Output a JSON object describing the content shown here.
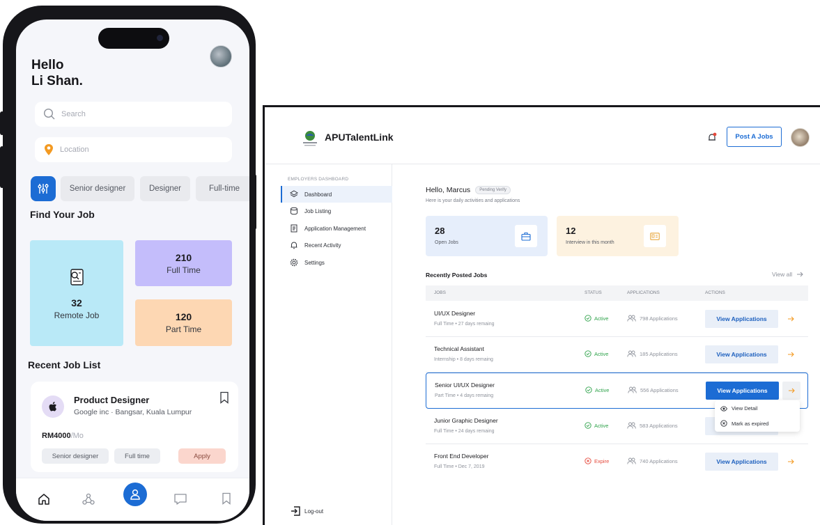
{
  "mobile": {
    "greeting_line1": "Hello",
    "greeting_line2": "Li Shan.",
    "search_placeholder": "Search",
    "location_placeholder": "Location",
    "filter_chips": [
      "Senior designer",
      "Designer",
      "Full-time"
    ],
    "find_job_title": "Find Your Job",
    "stats": {
      "remote": {
        "value": "32",
        "label": "Remote Job"
      },
      "full_time": {
        "value": "210",
        "label": "Full Time"
      },
      "part_time": {
        "value": "120",
        "label": "Part Time"
      }
    },
    "recent_title": "Recent Job List",
    "recent_job": {
      "title": "Product Designer",
      "company": "Google inc · Bangsar, Kuala Lumpur",
      "salary": "RM4000",
      "salary_period": "/Mo",
      "tags": [
        "Senior designer",
        "Full time"
      ],
      "apply_label": "Apply"
    },
    "colors": {
      "accent": "#1c6cd4",
      "remote_card": "#b9e9f7",
      "full_time_card": "#c4bdfb",
      "part_time_card": "#fdd7b3",
      "apply": "#fbd6cd"
    }
  },
  "desktop": {
    "brand": "APUTalentLink",
    "post_button": "Post A Jobs",
    "sidebar": {
      "section_title": "EMPLOYERS DASHBOARD",
      "items": [
        {
          "label": "Dashboard",
          "icon": "layers-icon"
        },
        {
          "label": "Job Listing",
          "icon": "database-icon"
        },
        {
          "label": "Application Management",
          "icon": "document-icon"
        },
        {
          "label": "Recent Activity",
          "icon": "bell-icon"
        },
        {
          "label": "Settings",
          "icon": "gear-icon"
        }
      ],
      "logout": "Log-out"
    },
    "hello": "Hello, Marcus",
    "status_badge": "Pending Verify",
    "subtitle": "Here is your daily activities and applications",
    "stats": [
      {
        "value": "28",
        "label": "Open Jobs"
      },
      {
        "value": "12",
        "label": "Interview in this month"
      }
    ],
    "recent_title": "Recently Posted Jobs",
    "view_all": "View all",
    "table": {
      "headers": [
        "JOBS",
        "STATUS",
        "APPLICATIONS",
        "ACTIONS"
      ],
      "rows": [
        {
          "title": "UI/UX Designer",
          "meta": "Full Time  •  27 days remaing",
          "status": "Active",
          "apps": "798 Applications",
          "action": "View Applications"
        },
        {
          "title": "Technical Assistant",
          "meta": "Internship  •  8 days remaing",
          "status": "Active",
          "apps": "185 Applications",
          "action": "View Applications"
        },
        {
          "title": "Senior UI/UX Designer",
          "meta": "Part Time  •  4 days remaing",
          "status": "Active",
          "apps": "556 Applications",
          "action": "View Applications"
        },
        {
          "title": "Junior Graphic Designer",
          "meta": "Full Time  •  24 days remaing",
          "status": "Active",
          "apps": "583 Applications",
          "action": "View Applications"
        },
        {
          "title": "Front End Developer",
          "meta": "Full Time  •  Dec 7, 2019",
          "status": "Expire",
          "apps": "740 Applications",
          "action": "View Applications"
        }
      ]
    },
    "context_menu": [
      "View Detail",
      "Mark as expired"
    ],
    "colors": {
      "accent": "#1c6cd4",
      "active": "#2ea24a",
      "expire": "#e5483b",
      "open_jobs_card": "#e6eefb",
      "interview_card": "#fdf2e0"
    }
  }
}
